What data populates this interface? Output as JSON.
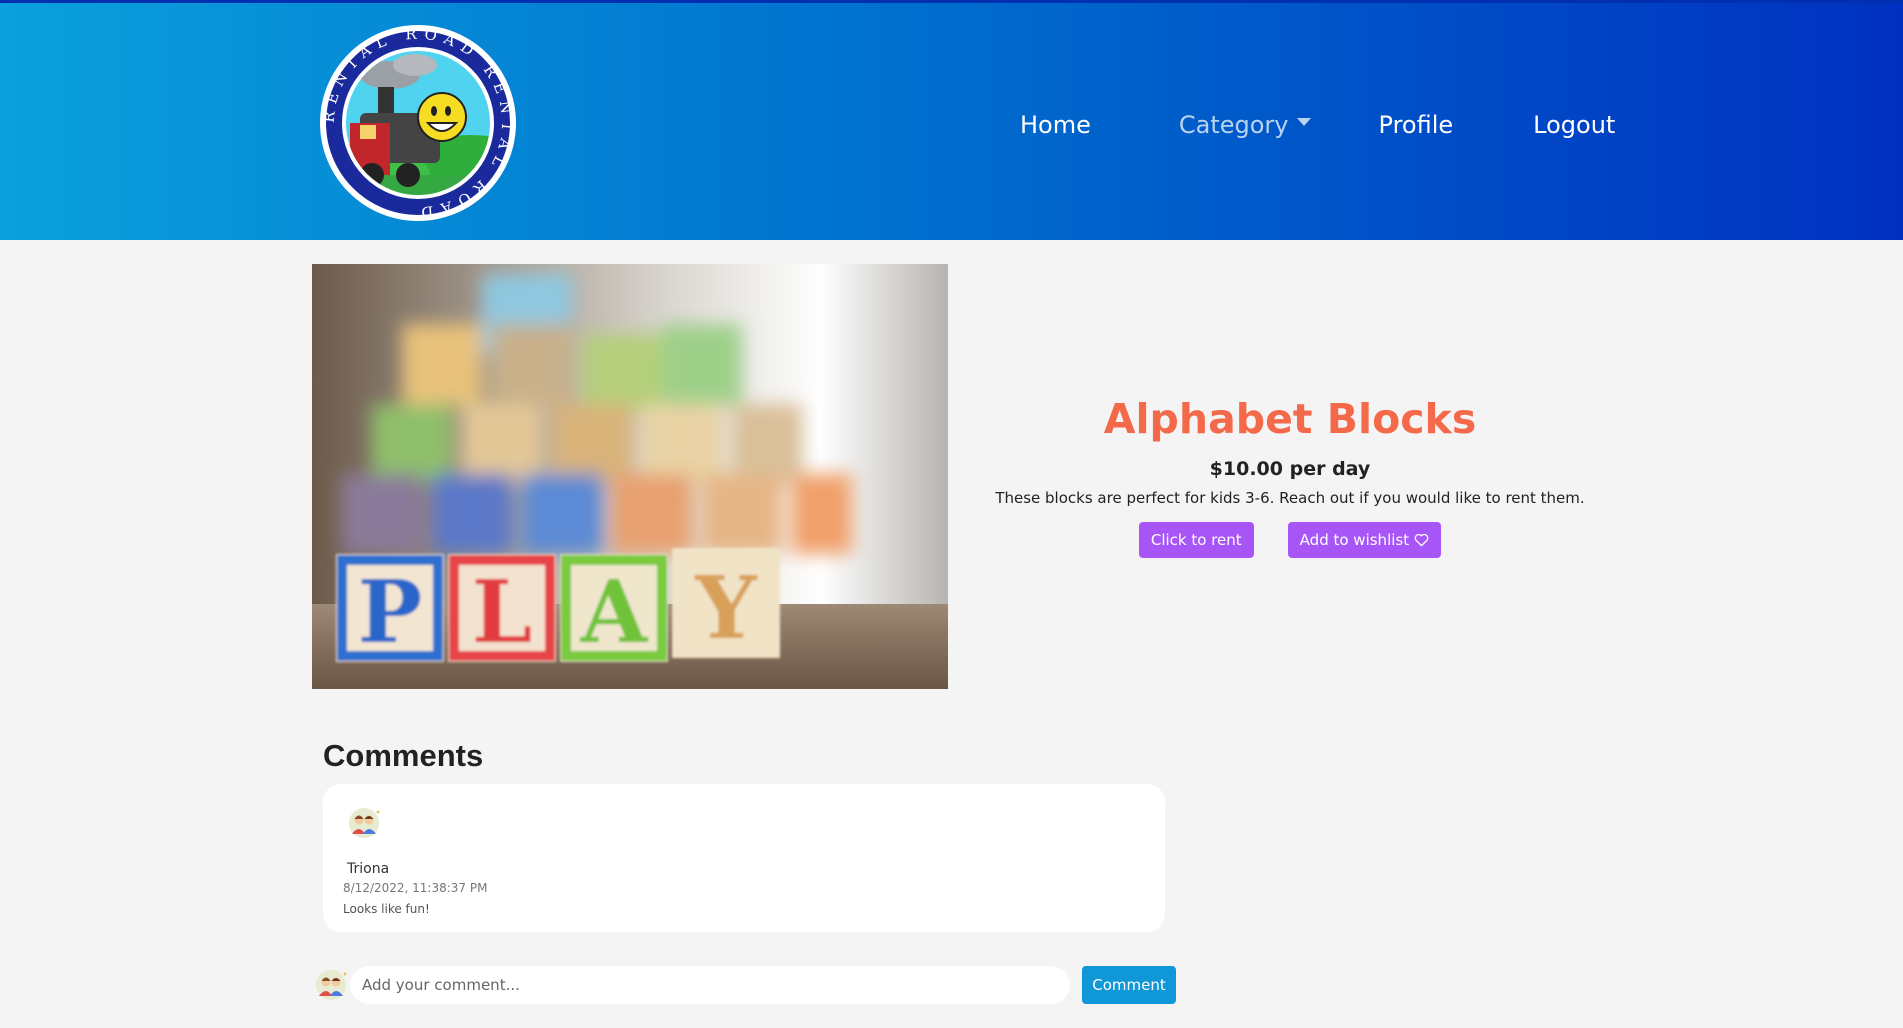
{
  "nav": {
    "home": "Home",
    "category": "Category",
    "profile": "Profile",
    "logout": "Logout"
  },
  "logo": {
    "ring_text": "RENTAL ROAD RENTAL ROAD",
    "icon": "smiling-train-logo"
  },
  "product": {
    "image_blocks": [
      "P",
      "L",
      "A",
      "Y"
    ],
    "title": "Alphabet Blocks",
    "price": "$10.00 per day",
    "description": "These blocks are perfect for kids 3-6. Reach out if you would like to rent them.",
    "rent_label": "Click to rent",
    "wishlist_label": "Add to wishlist"
  },
  "comments": {
    "heading": "Comments",
    "items": [
      {
        "author": "Triona",
        "date": "8/12/2022, 11:38:37 PM",
        "text": "Looks like fun!"
      }
    ],
    "input_placeholder": "Add your comment...",
    "submit_label": "Comment"
  },
  "colors": {
    "title": "#f4694a",
    "button_purple": "#a855f7",
    "button_blue": "#0f97d8",
    "header_start": "#0aa0dc",
    "header_end": "#0030c0"
  }
}
